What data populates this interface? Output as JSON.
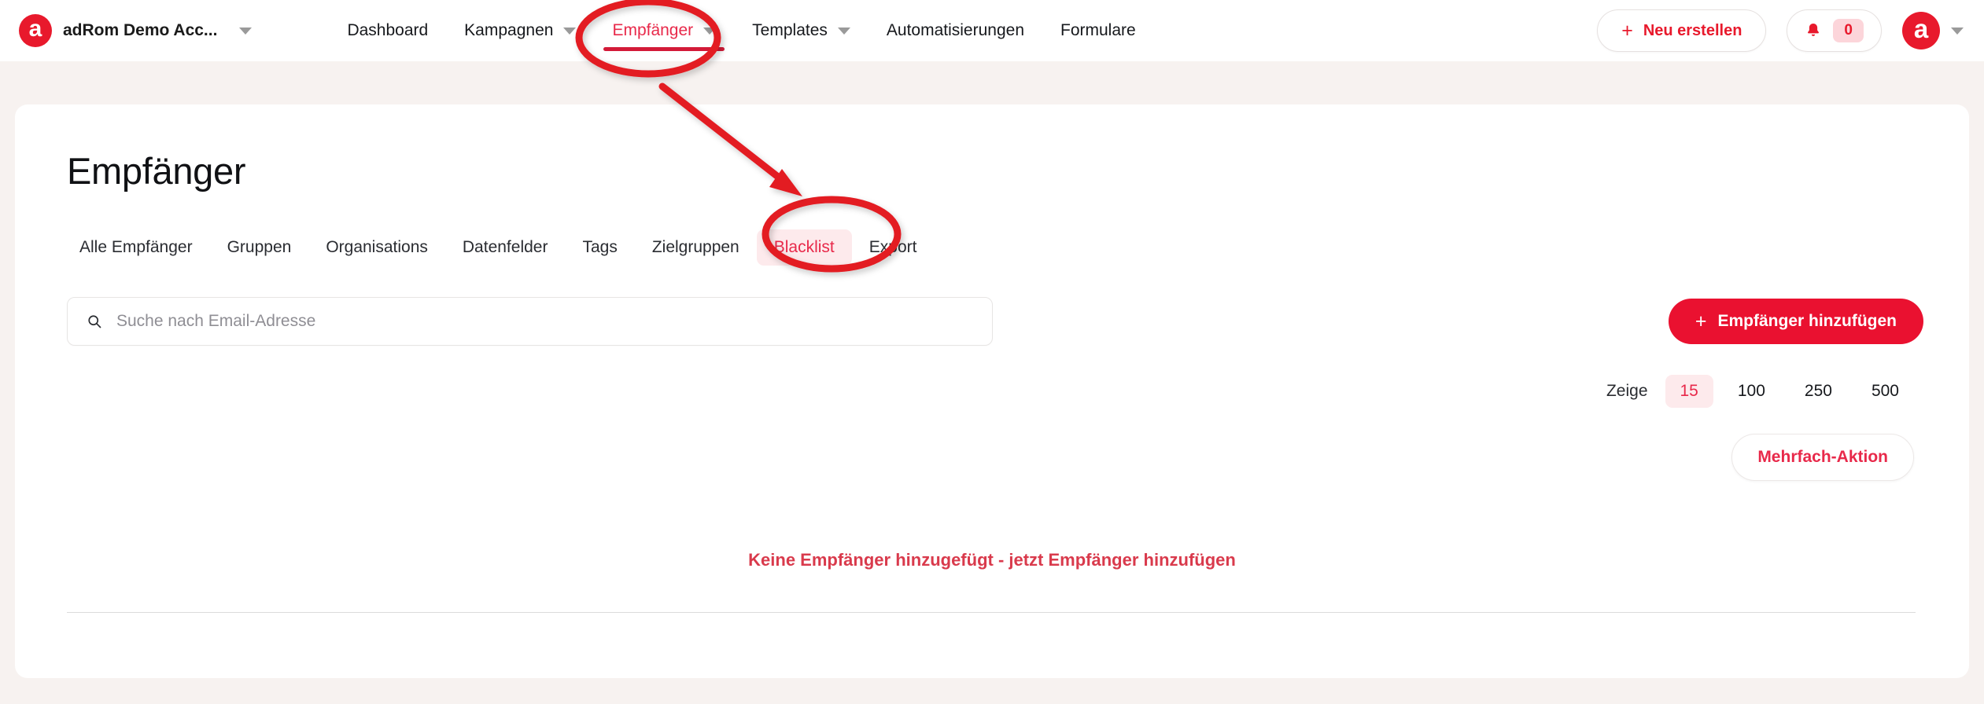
{
  "topbar": {
    "logo_glyph": "a",
    "account_name": "adRom Demo Acc...",
    "nav": [
      {
        "label": "Dashboard",
        "has_caret": false,
        "active": false
      },
      {
        "label": "Kampagnen",
        "has_caret": true,
        "active": false
      },
      {
        "label": "Empfänger",
        "has_caret": true,
        "active": true
      },
      {
        "label": "Templates",
        "has_caret": true,
        "active": false
      },
      {
        "label": "Automatisierungen",
        "has_caret": false,
        "active": false
      },
      {
        "label": "Formulare",
        "has_caret": false,
        "active": false
      }
    ],
    "new_button": {
      "plus": "+",
      "label": "Neu erstellen"
    },
    "notifications": {
      "icon": "bell-icon",
      "count": "0"
    },
    "avatar_glyph": "a"
  },
  "page": {
    "title": "Empfänger",
    "tabs": [
      {
        "label": "Alle Empfänger",
        "active": false
      },
      {
        "label": "Gruppen",
        "active": false
      },
      {
        "label": "Organisations",
        "active": false
      },
      {
        "label": "Datenfelder",
        "active": false
      },
      {
        "label": "Tags",
        "active": false
      },
      {
        "label": "Zielgruppen",
        "active": false
      },
      {
        "label": "Blacklist",
        "active": true
      },
      {
        "label": "Export",
        "active": false
      }
    ],
    "search": {
      "icon": "search-icon",
      "placeholder": "Suche nach Email-Adresse",
      "value": ""
    },
    "add_button": {
      "plus": "+",
      "label": "Empfänger hinzufügen"
    },
    "page_size": {
      "label": "Zeige",
      "options": [
        {
          "label": "15",
          "active": true
        },
        {
          "label": "100",
          "active": false
        },
        {
          "label": "250",
          "active": false
        },
        {
          "label": "500",
          "active": false
        }
      ]
    },
    "multi_action_button": "Mehrfach-Aktion",
    "empty_message": "Keine Empfänger hinzugefügt - jetzt Empfänger hinzufügen"
  },
  "annotations": {
    "circle_nav_target": "Empfänger",
    "circle_tab_target": "Blacklist",
    "arrow": "nav-to-tab-arrow",
    "color": "#e31b23"
  },
  "colors": {
    "brand_red": "#e8192c",
    "accent_red": "#e8294a",
    "button_red": "#ea1130",
    "page_bg": "#f7f2f0",
    "card_bg": "#ffffff",
    "pill_pink": "#fdeaec",
    "annotation_red": "#e31b23"
  }
}
